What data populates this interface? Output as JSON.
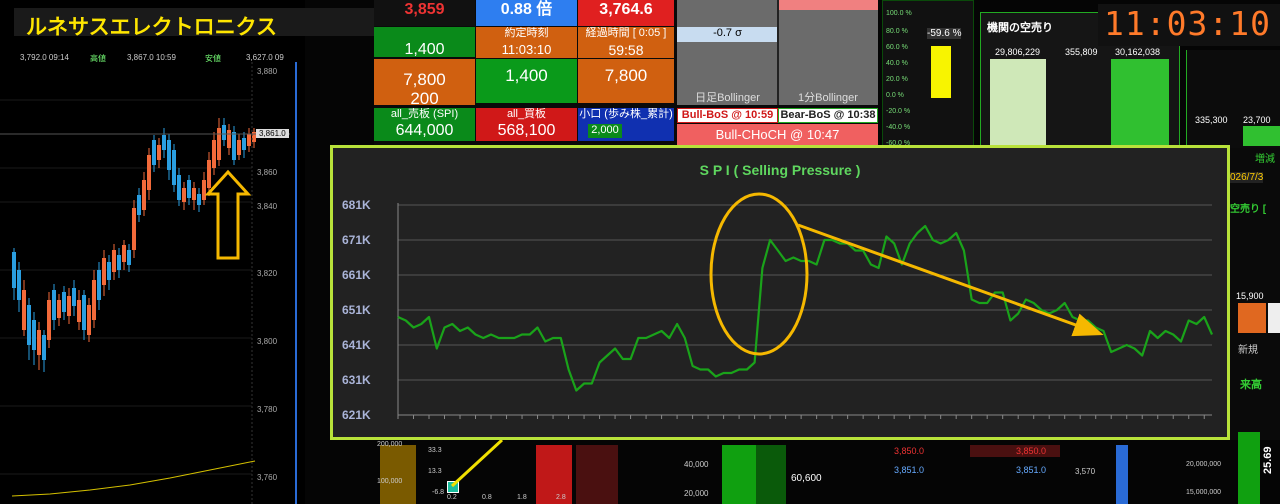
{
  "left_panel": {
    "company_name": "ルネサスエレクトロニクス",
    "top_info": {
      "low": "3,792.0 09:14",
      "low_label": "高値",
      "high": "3,867.0 10:59",
      "high_label": "安値",
      "last": "3,627.0 09"
    },
    "price_axis": [
      "3,880",
      "3,860",
      "3,840",
      "3,820",
      "3,800",
      "3,780",
      "3,760"
    ],
    "current_price_label": "3,861.0"
  },
  "grid_panel": {
    "row0": [
      "3,859",
      "0.88 倍",
      "3,764.6"
    ],
    "row1_labels": [
      "",
      "約定時刻",
      "経過時間 [ 0:05 ]"
    ],
    "row1_values": [
      "1,400",
      "11:03:10",
      "59:58"
    ],
    "row2": [
      "7,800",
      "1,400",
      "7,800"
    ],
    "row3": "200",
    "sigma": "-0.7 σ",
    "bollinger_labels": [
      "日足Bollinger",
      "1分Bollinger"
    ],
    "board_labels": [
      "all_売板 (SPI)",
      "all_買板",
      "小口 (歩み株_累計)"
    ],
    "board_values": [
      "644,000",
      "568,100",
      "2,000"
    ],
    "bos_labels": [
      "Bull-BoS @ 10:59",
      "Bear-BoS @ 10:38"
    ],
    "choch_label": "Bull-CHoCH @ 10:47"
  },
  "gauge_panel": {
    "ticks": [
      "100.0 %",
      "80.0 %",
      "60.0 %",
      "40.0 %",
      "20.0 %",
      "0.0 %",
      "-20.0 %",
      "-40.0 %",
      "-60.0 %"
    ],
    "value_label": "-59.6 %"
  },
  "short_panel": {
    "title": "機関の空売り",
    "values": [
      "29,806,229",
      "355,809",
      "30,162,038"
    ]
  },
  "right_edge": {
    "clock": "11:03:10",
    "values": [
      "335,300",
      "23,700"
    ],
    "labels": [
      "増減",
      "026/7/3",
      "空売り [",
      "15,900",
      "新規",
      "来高"
    ]
  },
  "bottom_strip": {
    "axis1": [
      "200,000",
      "100,000"
    ],
    "mini_axis": [
      "33.3",
      "13.3",
      "-6.8"
    ],
    "mini_x": [
      "0.2",
      "0.8",
      "1.8",
      "2.8"
    ],
    "axis2": [
      "40,000",
      "20,000"
    ],
    "value": "60,600",
    "prices": [
      "3,850.0",
      "3,851.0",
      "3,850.0",
      "3,851.0"
    ],
    "axis3": "3,570",
    "axis4": [
      "20,000,000",
      "15,000,000"
    ],
    "edge_value": "25.69"
  },
  "chart_data": {
    "type": "line",
    "title": "S P I ( Selling Pressure )",
    "ylim": [
      621000,
      681000
    ],
    "y_ticks": [
      "681K",
      "671K",
      "661K",
      "651K",
      "641K",
      "631K",
      "621K"
    ],
    "series": [
      {
        "values": [
          649000,
          648000,
          646000,
          647000,
          649000,
          640000,
          646000,
          647000,
          645000,
          646000,
          644000,
          643000,
          644000,
          643000,
          643000,
          643000,
          644000,
          644000,
          646000,
          642000,
          643000,
          643000,
          634000,
          628000,
          630000,
          630000,
          636000,
          638000,
          640000,
          637000,
          637000,
          643000,
          643000,
          644000,
          645000,
          643000,
          647000,
          643000,
          635000,
          634000,
          634000,
          632000,
          633000,
          633000,
          634000,
          634000,
          636000,
          663000,
          671000,
          668000,
          665000,
          666000,
          665000,
          665000,
          664000,
          671000,
          671000,
          670000,
          670000,
          668000,
          668000,
          664000,
          663000,
          672000,
          670000,
          664000,
          670000,
          673000,
          675000,
          671000,
          670000,
          671000,
          673000,
          668000,
          654000,
          653000,
          653000,
          656000,
          656000,
          648000,
          650000,
          654000,
          653000,
          651000,
          650000,
          651000,
          653000,
          649000,
          648000,
          648000,
          646000,
          645000,
          639000,
          640000,
          641000,
          640000,
          638000,
          645000,
          643000,
          645000,
          644000,
          642000,
          648000,
          647000,
          649000,
          644000
        ]
      }
    ]
  }
}
